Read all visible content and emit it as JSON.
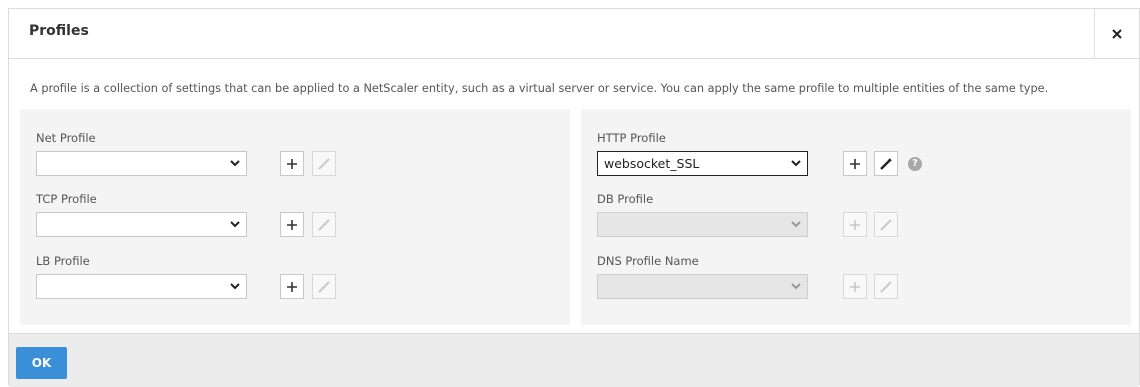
{
  "dialog": {
    "title": "Profiles",
    "description": "A profile is a collection of settings that can be applied to a NetScaler entity, such as a virtual server or service. You can apply the same profile to multiple entities of the same type."
  },
  "left_fields": [
    {
      "label": "Net Profile",
      "value": ""
    },
    {
      "label": "TCP Profile",
      "value": ""
    },
    {
      "label": "LB Profile",
      "value": ""
    }
  ],
  "right_fields": [
    {
      "label": "HTTP Profile",
      "value": "websocket_SSL"
    },
    {
      "label": "DB Profile",
      "value": ""
    },
    {
      "label": "DNS Profile Name",
      "value": ""
    }
  ],
  "help_symbol": "?",
  "footer": {
    "ok_label": "OK"
  },
  "colors": {
    "accent": "#3a8fd8",
    "panel": "#f4f4f4"
  }
}
